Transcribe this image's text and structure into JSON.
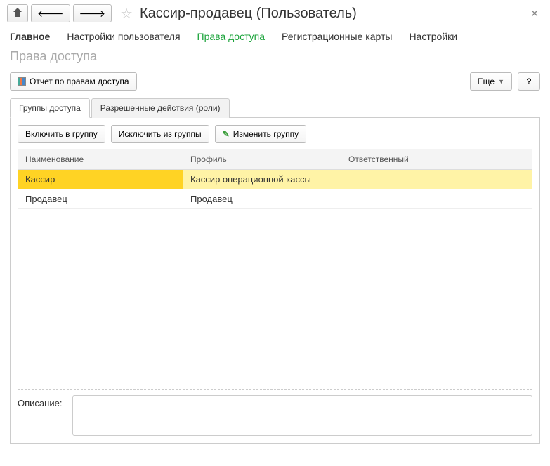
{
  "header": {
    "title": "Кассир-продавец (Пользователь)"
  },
  "menu": {
    "items": [
      {
        "label": "Главное",
        "bold": true
      },
      {
        "label": "Настройки пользователя"
      },
      {
        "label": "Права доступа",
        "active": true
      },
      {
        "label": "Регистрационные карты"
      },
      {
        "label": "Настройки"
      }
    ]
  },
  "subtitle": "Права доступа",
  "toolbar": {
    "report_label": "Отчет по правам доступа",
    "more_label": "Еще",
    "help_label": "?"
  },
  "tabs": {
    "items": [
      {
        "label": "Группы доступа",
        "active": true
      },
      {
        "label": "Разрешенные действия (роли)"
      }
    ]
  },
  "inner_toolbar": {
    "include_label": "Включить в группу",
    "exclude_label": "Исключить из группы",
    "edit_label": "Изменить группу"
  },
  "grid": {
    "columns": [
      "Наименование",
      "Профиль",
      "Ответственный"
    ],
    "rows": [
      {
        "name": "Кассир",
        "profile": "Кассир операционной кассы",
        "responsible": "",
        "selected": true
      },
      {
        "name": "Продавец",
        "profile": "Продавец",
        "responsible": ""
      }
    ]
  },
  "description": {
    "label": "Описание:",
    "value": ""
  }
}
